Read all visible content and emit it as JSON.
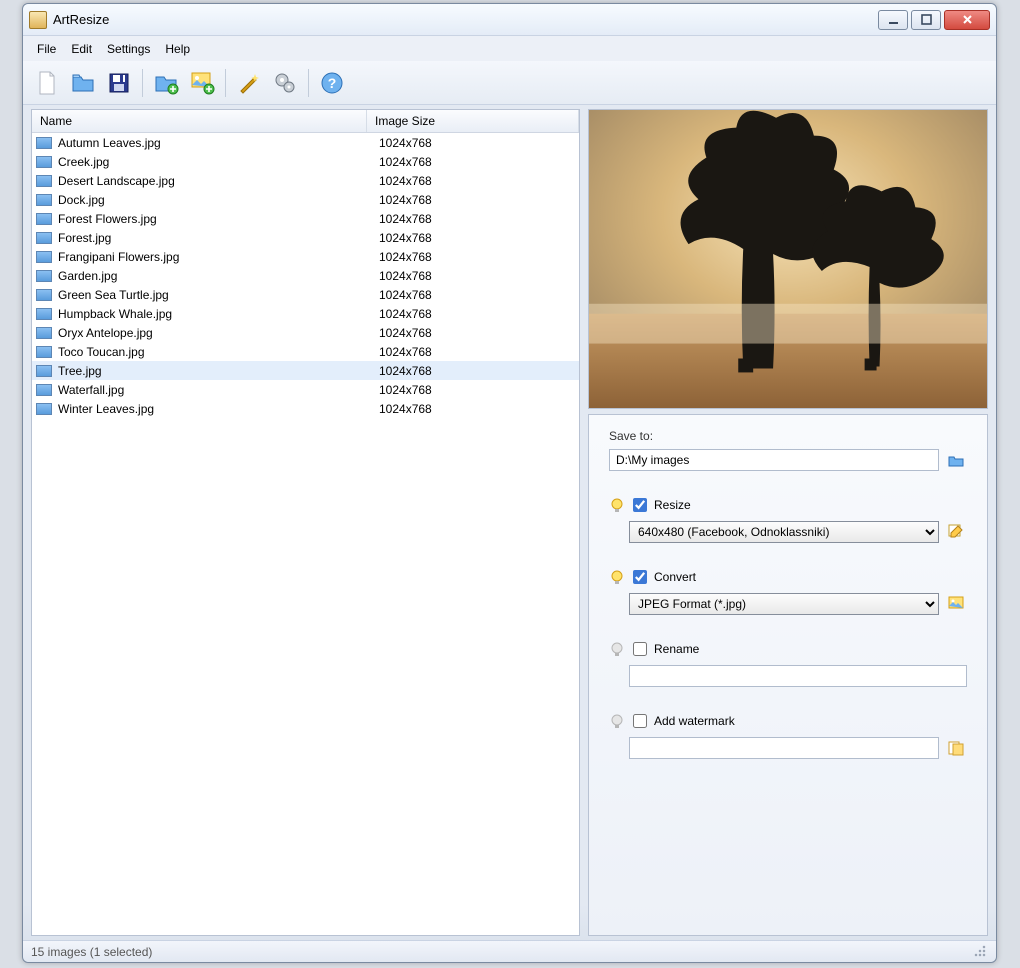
{
  "window": {
    "title": "ArtResize"
  },
  "menu": {
    "file": "File",
    "edit": "Edit",
    "settings": "Settings",
    "help": "Help"
  },
  "list": {
    "header_name": "Name",
    "header_size": "Image Size",
    "selected_index": 12,
    "items": [
      {
        "name": "Autumn Leaves.jpg",
        "size": "1024x768"
      },
      {
        "name": "Creek.jpg",
        "size": "1024x768"
      },
      {
        "name": "Desert Landscape.jpg",
        "size": "1024x768"
      },
      {
        "name": "Dock.jpg",
        "size": "1024x768"
      },
      {
        "name": "Forest Flowers.jpg",
        "size": "1024x768"
      },
      {
        "name": "Forest.jpg",
        "size": "1024x768"
      },
      {
        "name": "Frangipani Flowers.jpg",
        "size": "1024x768"
      },
      {
        "name": "Garden.jpg",
        "size": "1024x768"
      },
      {
        "name": "Green Sea Turtle.jpg",
        "size": "1024x768"
      },
      {
        "name": "Humpback Whale.jpg",
        "size": "1024x768"
      },
      {
        "name": "Oryx Antelope.jpg",
        "size": "1024x768"
      },
      {
        "name": "Toco Toucan.jpg",
        "size": "1024x768"
      },
      {
        "name": "Tree.jpg",
        "size": "1024x768"
      },
      {
        "name": "Waterfall.jpg",
        "size": "1024x768"
      },
      {
        "name": "Winter Leaves.jpg",
        "size": "1024x768"
      }
    ]
  },
  "options": {
    "save_to_label": "Save to:",
    "save_to_value": "D:\\My images",
    "resize_label": "Resize",
    "resize_checked": true,
    "resize_value": "640x480 (Facebook, Odnoklassniki)",
    "convert_label": "Convert",
    "convert_checked": true,
    "convert_value": "JPEG Format (*.jpg)",
    "rename_label": "Rename",
    "rename_checked": false,
    "rename_value": "",
    "watermark_label": "Add watermark",
    "watermark_checked": false,
    "watermark_value": ""
  },
  "status": {
    "text": "15 images (1 selected)"
  }
}
